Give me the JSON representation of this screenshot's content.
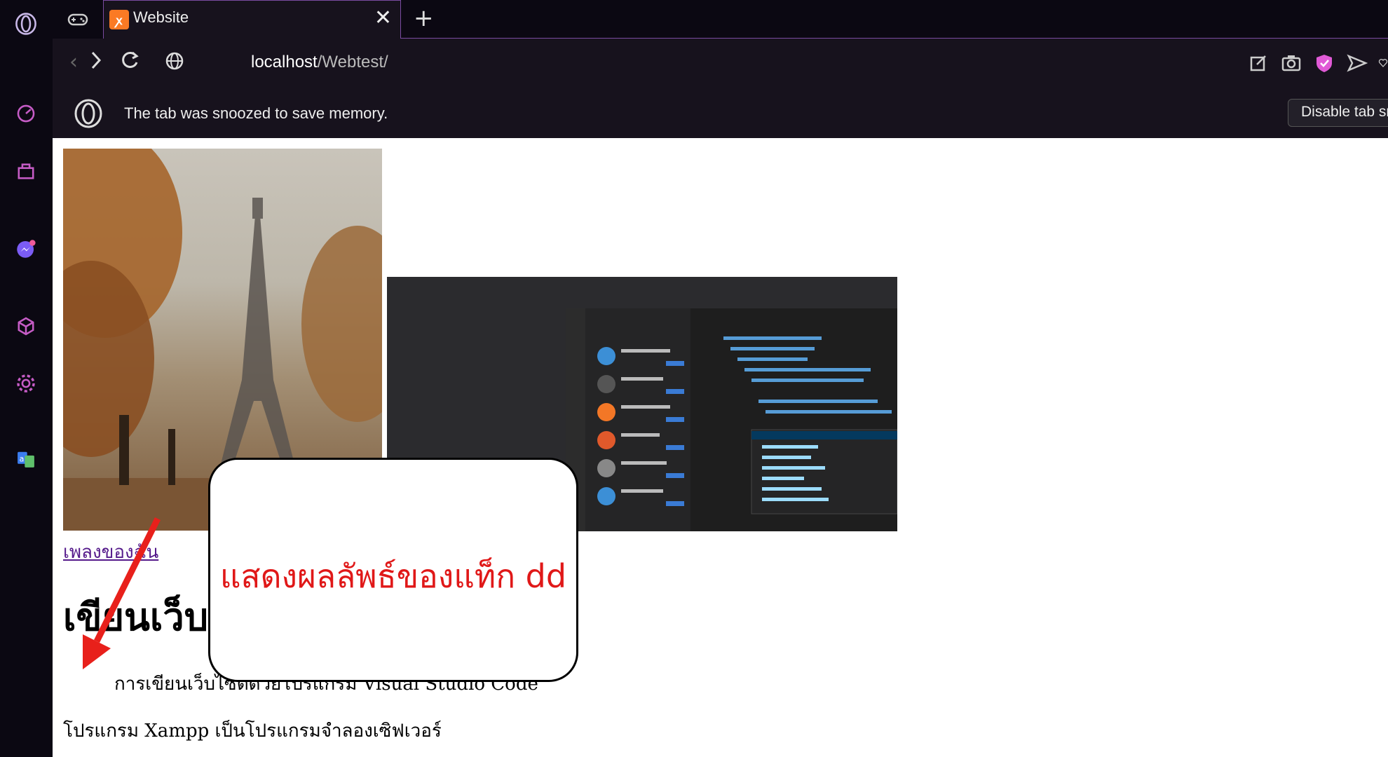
{
  "browser": {
    "tab": {
      "title": "Website",
      "favicon": "xampp-icon"
    },
    "address": {
      "host": "localhost",
      "path": "/Webtest/"
    },
    "infobar": {
      "message": "The tab was snoozed to save memory.",
      "button": "Disable tab snoozing"
    },
    "sidebar_icons": [
      "opera-logo-icon",
      "speed-dial-icon",
      "briefcase-icon",
      "messenger-icon",
      "cube-icon",
      "settings-icon",
      "translate-icon"
    ],
    "accent": "#7a4ba1"
  },
  "page": {
    "link": "เพลงของฉัน",
    "heading": "เขียนเว็บ",
    "para1": "การเขียนเว็บไซต์ด้วยโปรแกรม Visual Studio Code",
    "para2": "โปรแกรม Xampp เป็นโปรแกรมจำลองเซิฟเวอร์"
  },
  "annotation": {
    "text": "แสดงผลลัพธ์ของแท็ก dd",
    "color": "#e01818"
  }
}
